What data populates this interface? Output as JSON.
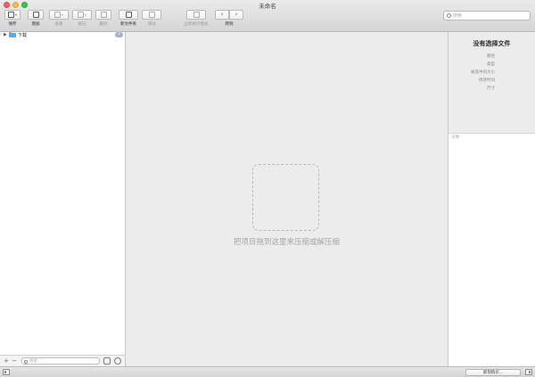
{
  "window": {
    "title": "未命名"
  },
  "toolbar": {
    "save": "保存",
    "add": "增加",
    "view": "查看",
    "extract": "解压",
    "delete": "删除",
    "new_folder": "新文件夹",
    "test": "测试",
    "run_now": "立即执行模式",
    "navigate": "转到"
  },
  "search": {
    "placeholder": "搜索"
  },
  "sidebar": {
    "items": [
      {
        "label": "下载",
        "badge": "2"
      }
    ],
    "footer": {
      "add": "+",
      "remove": "−",
      "search_placeholder": "搜索"
    }
  },
  "main": {
    "drop_hint": "把项目拖到这里来压缩或解压缩"
  },
  "info": {
    "title": "没有选择文件",
    "labels": [
      "路径",
      "类型",
      "被选中的大小",
      "修改时间",
      "尺寸"
    ],
    "notes_placeholder": "注释"
  },
  "statusbar": {
    "button": "即刻购买..."
  }
}
